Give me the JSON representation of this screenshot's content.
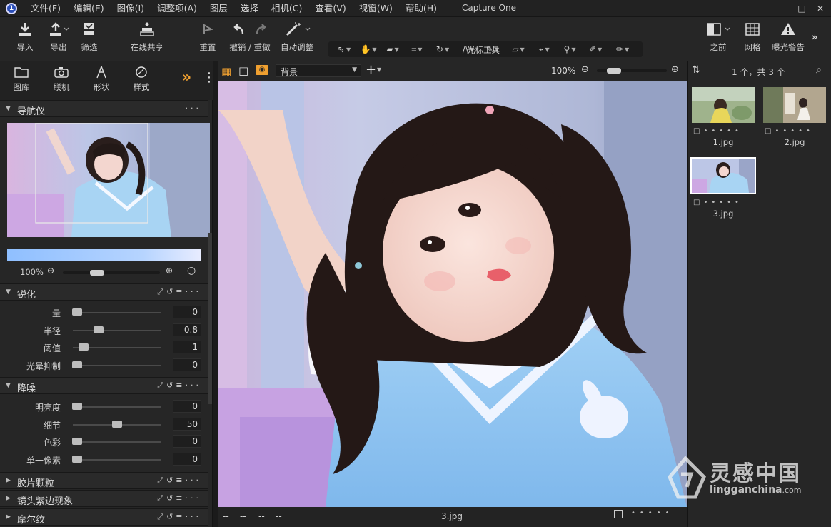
{
  "app": {
    "logo_letter": "1",
    "title": "Capture One"
  },
  "menu": [
    "文件(F)",
    "编辑(E)",
    "图像(I)",
    "调整项(A)",
    "图层",
    "选择",
    "相机(C)",
    "查看(V)",
    "视窗(W)",
    "帮助(H)"
  ],
  "window_controls": {
    "minimize": "—",
    "maximize": "□",
    "close": "✕"
  },
  "toolbar": {
    "import": "导入",
    "export": "导出",
    "filter": "筛选",
    "live_share": "在线共享",
    "reset": "重置",
    "undo_redo": "撤销 / 重做",
    "auto_adjust": "自动调整",
    "cursor_tools": "光标工具",
    "before": "之前",
    "grid": "网格",
    "exposure_warning": "曝光警告",
    "more": "»"
  },
  "left_tabs": {
    "library": "图库",
    "tether": "联机",
    "shape": "形状",
    "style": "样式",
    "more_icon": "»",
    "menu_icon": "⋮"
  },
  "navigator": {
    "title": "导航仪",
    "zoom": "100%",
    "menu": "···"
  },
  "sharpening": {
    "title": "锐化",
    "rows": [
      {
        "label": "量",
        "value": "0",
        "pos": 0.05
      },
      {
        "label": "半径",
        "value": "0.8",
        "pos": 0.29
      },
      {
        "label": "阈值",
        "value": "1",
        "pos": 0.12
      },
      {
        "label": "光晕抑制",
        "value": "0",
        "pos": 0.05
      }
    ]
  },
  "noise": {
    "title": "降噪",
    "rows": [
      {
        "label": "明亮度",
        "value": "0",
        "pos": 0.05
      },
      {
        "label": "细节",
        "value": "50",
        "pos": 0.5
      },
      {
        "label": "色彩",
        "value": "0",
        "pos": 0.05
      },
      {
        "label": "单一像素",
        "value": "0",
        "pos": 0.05
      }
    ]
  },
  "collapsed_sections": [
    "胶片颗粒",
    "镜头紫边现象",
    "摩尔纹"
  ],
  "viewer_bar": {
    "layer": "背景",
    "zoom": "100%",
    "add": "+"
  },
  "viewer_status": {
    "dashes": [
      "--",
      "--",
      "--",
      "--"
    ],
    "filename": "3.jpg"
  },
  "browser": {
    "count": "1 个，共 3 个",
    "items": [
      {
        "name": "1.jpg"
      },
      {
        "name": "2.jpg"
      },
      {
        "name": "3.jpg",
        "selected": true
      }
    ]
  },
  "watermark": {
    "cn": "灵感中国",
    "en": "lingganchina",
    "suffix": ".com"
  },
  "colors": {
    "accent": "#f0a030",
    "panel": "#262626",
    "selection": "#ffffff"
  }
}
